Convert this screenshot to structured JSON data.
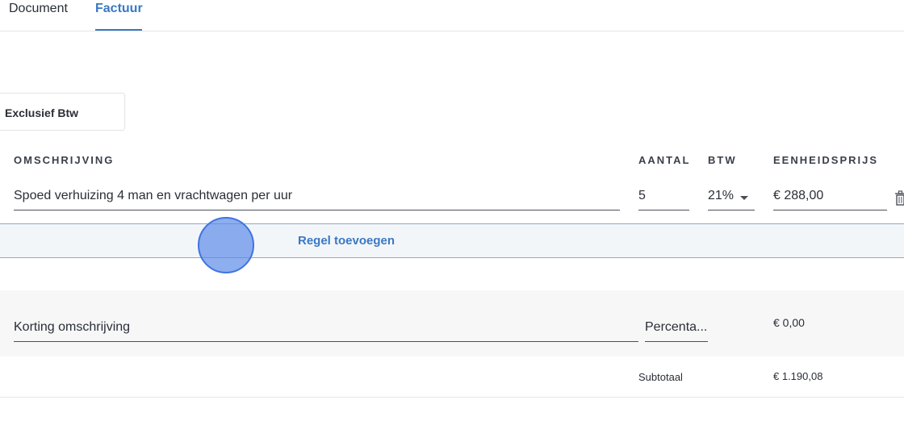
{
  "tabs": [
    {
      "label": "Document",
      "active": false
    },
    {
      "label": "Factuur",
      "active": true
    }
  ],
  "tax_mode": {
    "selected": "Exclusief Btw"
  },
  "columns": {
    "description": "OMSCHRIJVING",
    "quantity": "AANTAL",
    "vat": "BTW",
    "unit_price": "EENHEIDSPRIJS"
  },
  "line_items": [
    {
      "description": "Spoed verhuizing 4 man en vrachtwagen per uur",
      "quantity": "5",
      "vat": "21%",
      "unit_price": "€ 288,00"
    }
  ],
  "add_line_label": "Regel toevoegen",
  "discount": {
    "description_placeholder": "Korting omschrijving",
    "percentage_placeholder": "Percenta...",
    "amount": "€ 0,00"
  },
  "totals": {
    "subtotal_label": "Subtotaal",
    "subtotal_value": "€ 1.190,08"
  },
  "colors": {
    "accent": "#3a78c4",
    "cursor": "#5c8ce8"
  }
}
